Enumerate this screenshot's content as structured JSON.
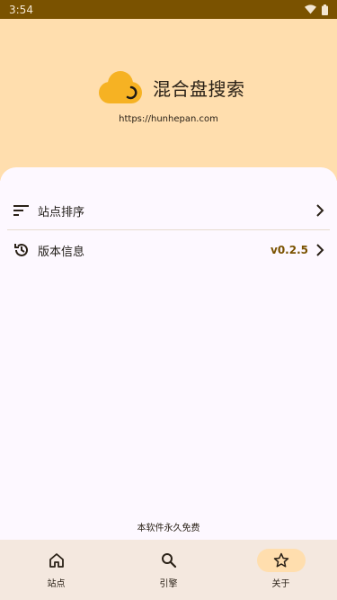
{
  "status_bar": {
    "time": "3:54"
  },
  "header": {
    "app_name": "混合盘搜索",
    "site_url": "https://hunhepan.com"
  },
  "settings": [
    {
      "label": "站点排序",
      "icon": "sort-icon",
      "value": ""
    },
    {
      "label": "版本信息",
      "icon": "history-icon",
      "value": "v0.2.5"
    }
  ],
  "footer_note": "本软件永久免费",
  "nav": {
    "items": [
      {
        "label": "站点",
        "icon": "home-icon",
        "active": false
      },
      {
        "label": "引擎",
        "icon": "search-icon",
        "active": false
      },
      {
        "label": "关于",
        "icon": "star-icon",
        "active": true
      }
    ]
  },
  "colors": {
    "status_bar": "#7a5200",
    "header_bg": "#ffdeae",
    "accent": "#7a5200",
    "logo": "#f6b223",
    "nav_bg": "#f4e8df"
  }
}
